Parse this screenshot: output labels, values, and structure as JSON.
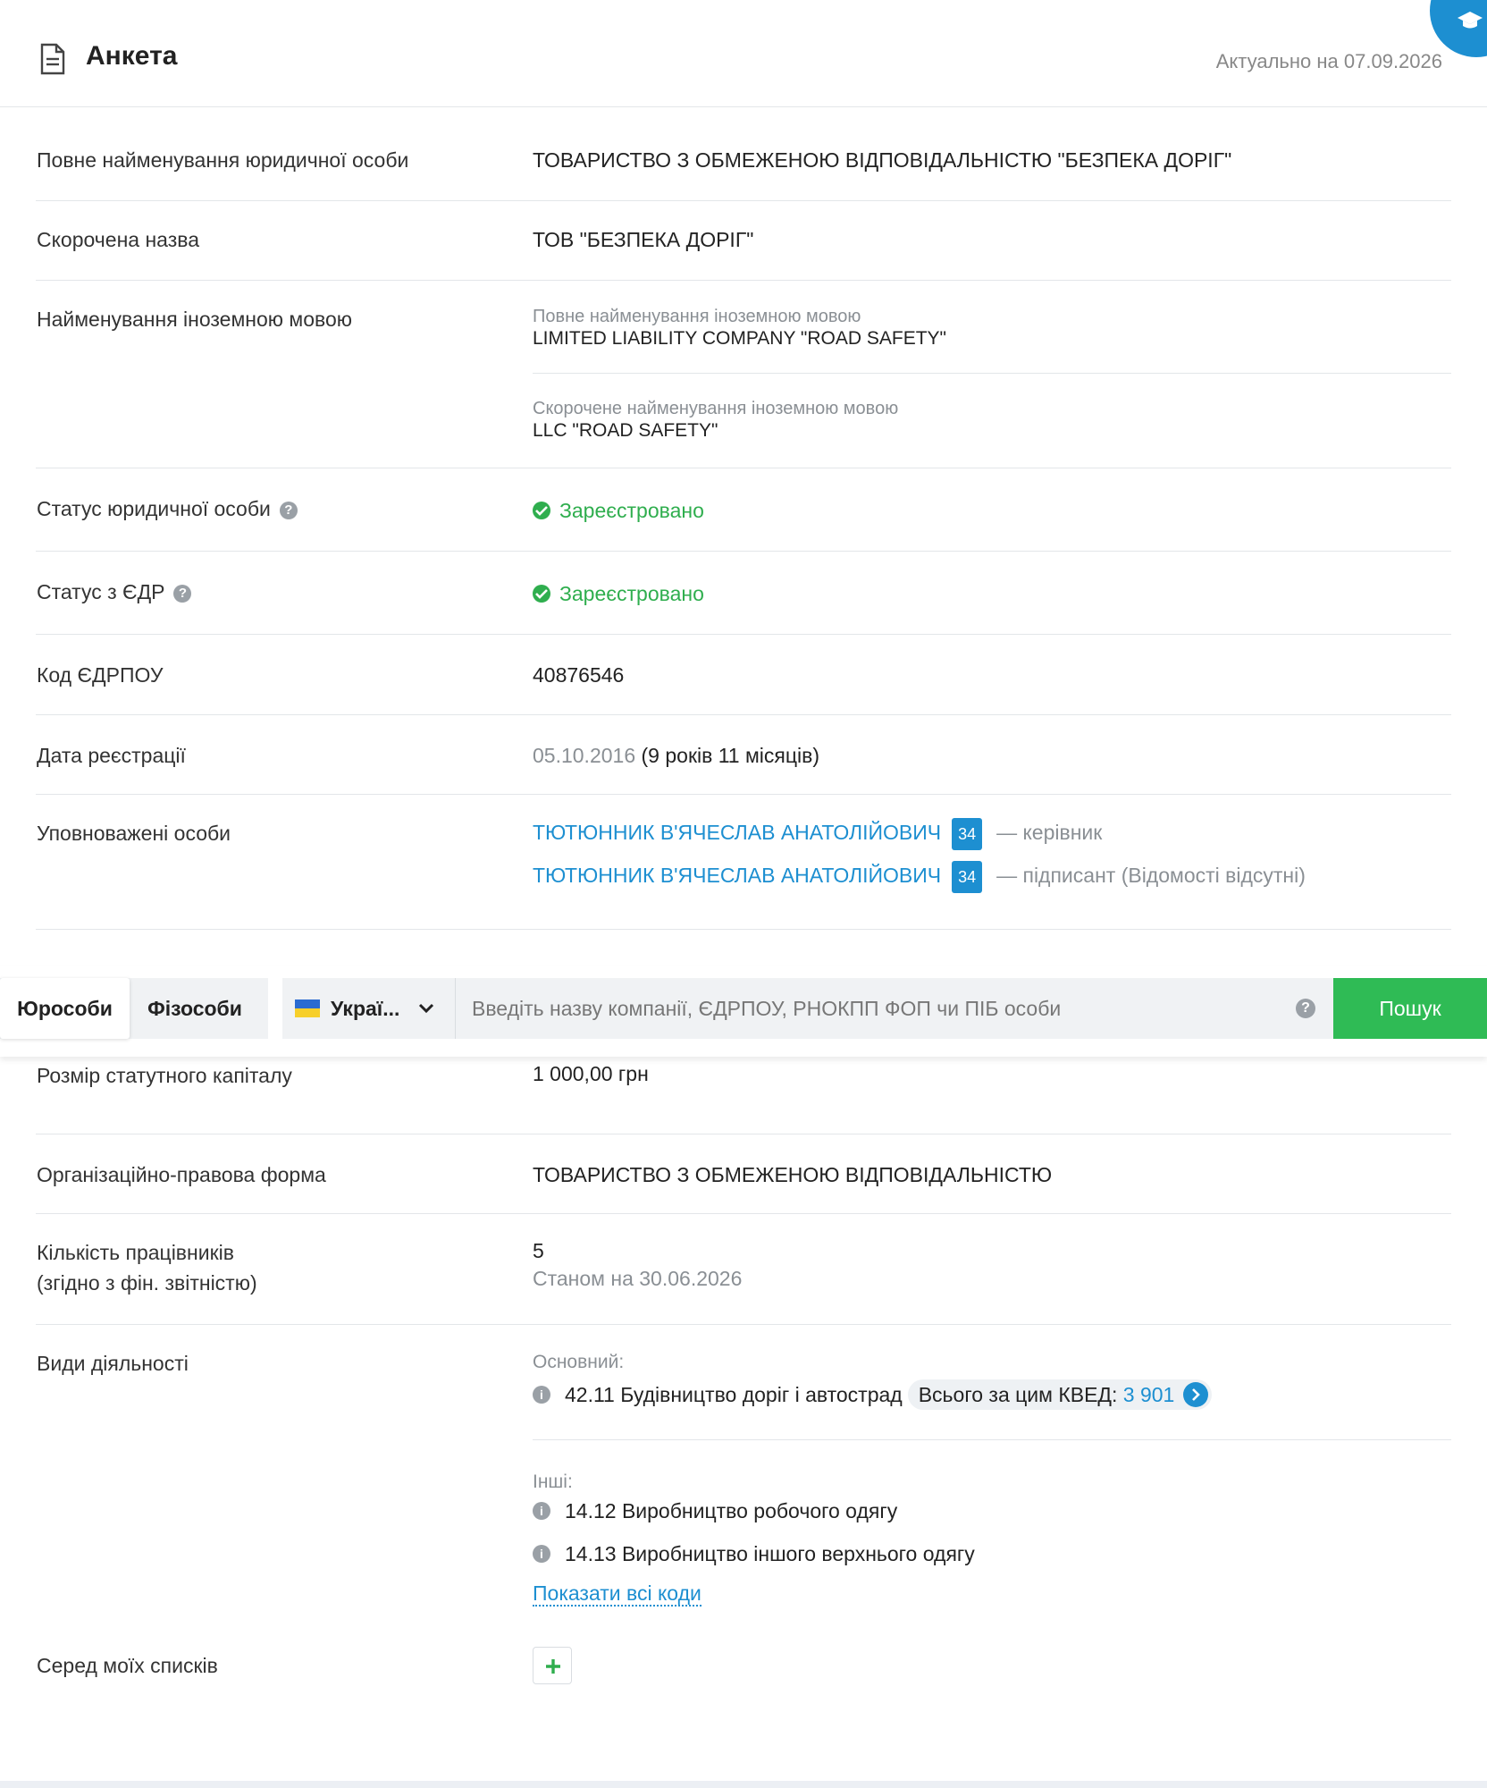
{
  "header": {
    "title": "Анкета",
    "actual_date": "Актуально на 07.09.2026"
  },
  "fields": {
    "full_name": {
      "label": "Повне найменування юридичної особи",
      "value": "ТОВАРИСТВО З ОБМЕЖЕНОЮ ВІДПОВІДАЛЬНІСТЮ \"БЕЗПЕКА ДОРІГ\""
    },
    "short_name": {
      "label": "Скорочена назва",
      "value": "ТОВ \"БЕЗПЕКА ДОРІГ\""
    },
    "foreign": {
      "label": "Найменування іноземною мовою",
      "full_label": "Повне найменування іноземною мовою",
      "full_value": "LIMITED LIABILITY COMPANY \"ROAD SAFETY\"",
      "short_label": "Скорочене найменування іноземною мовою",
      "short_value": "LLC \"ROAD SAFETY\""
    },
    "status_entity": {
      "label": "Статус юридичної особи",
      "value": "Зареєстровано"
    },
    "status_edr": {
      "label": "Статус з ЄДР",
      "value": "Зареєстровано"
    },
    "edrpou": {
      "label": "Код ЄДРПОУ",
      "value": "40876546"
    },
    "reg_date": {
      "label": "Дата реєстрації",
      "date": "05.10.2016",
      "duration": "(9 років 11 місяців)"
    },
    "authorized": {
      "label": "Уповноважені особи",
      "persons": [
        {
          "name": "ТЮТЮННИК В'ЯЧЕСЛАВ АНАТОЛІЙОВИЧ",
          "badge": "34",
          "role": "— керівник"
        },
        {
          "name": "ТЮТЮННИК В'ЯЧЕСЛАВ АНАТОЛІЙОВИЧ",
          "badge": "34",
          "role": "— підписант (Відомості відсутні)"
        }
      ]
    },
    "capital": {
      "label": "Розмір статутного капіталу",
      "value": "1 000,00 грн"
    },
    "legal_form": {
      "label": "Організаційно-правова форма",
      "value": "ТОВАРИСТВО З ОБМЕЖЕНОЮ ВІДПОВІДАЛЬНІСТЮ"
    },
    "employees": {
      "label_line1": "Кількість працівників",
      "label_line2": "(згідно з фін. звітністю)",
      "value": "5",
      "as_of": "Станом на 30.06.2026"
    },
    "activities": {
      "label": "Види діяльності",
      "main_label": "Основний:",
      "main_code": "42.11 Будівництво доріг і автострад",
      "kved_total_label": "Всього за цим КВЕД:",
      "kved_total_value": "3 901",
      "others_label": "Інші:",
      "others": [
        "14.12 Виробництво робочого одягу",
        "14.13 Виробництво іншого верхнього одягу"
      ],
      "show_all": "Показати всі коди"
    },
    "lists": {
      "label": "Серед моїх списків"
    }
  },
  "search": {
    "tabs": [
      "Юрособи",
      "Фізособи"
    ],
    "active_tab": "Юрособи",
    "country": "Украї...",
    "placeholder": "Введіть назву компанії, ЄДРПОУ, РНОКПП ФОП чи ПІБ особи",
    "button": "Пошук"
  },
  "colors": {
    "accent_blue": "#1d8fd1",
    "green": "#2fae4e",
    "search_button": "#2fbb55"
  },
  "icons": [
    "document-icon",
    "graduation-cap-icon",
    "help-icon",
    "check-circle-icon",
    "info-icon",
    "chevron-right-icon",
    "chevron-down-icon",
    "plus-icon",
    "ukraine-flag-icon"
  ]
}
